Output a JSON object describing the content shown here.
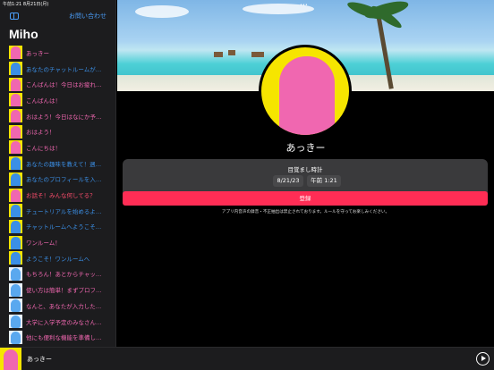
{
  "status": {
    "time": "午前1:21",
    "date": "8月21日(月)"
  },
  "sidebar": {
    "contact_label": "お問い合わせ",
    "title": "Miho",
    "items": [
      {
        "avatar": "pink",
        "text": "あっきー",
        "color": "pink"
      },
      {
        "avatar": "blue",
        "text": "あなたのチャットルームが…",
        "color": "blue"
      },
      {
        "avatar": "pink",
        "text": "こんばんは！今日はお疲れ…",
        "color": "pink"
      },
      {
        "avatar": "pink",
        "text": "こんばんは！",
        "color": "pink"
      },
      {
        "avatar": "pink",
        "text": "おはよう！今日はなにか予…",
        "color": "pink"
      },
      {
        "avatar": "pink",
        "text": "おはよう！",
        "color": "pink"
      },
      {
        "avatar": "pink",
        "text": "こんにちは！",
        "color": "pink"
      },
      {
        "avatar": "blue",
        "text": "あなたの趣味を教えて！週…",
        "color": "blue"
      },
      {
        "avatar": "blue",
        "text": "あなたのプロフィールを入…",
        "color": "blue"
      },
      {
        "avatar": "pink",
        "text": "お話そ！みんな何してる？",
        "color": "red"
      },
      {
        "avatar": "blue",
        "text": "チュートリアルを始めるよ…",
        "color": "blue"
      },
      {
        "avatar": "blue",
        "text": "チャットルームへようこそ…",
        "color": "blue"
      },
      {
        "avatar": "blue",
        "text": "ワンルーム！",
        "color": "pink"
      },
      {
        "avatar": "blue",
        "text": "ようこそ！ワンルームへ",
        "color": "blue"
      },
      {
        "avatar": "ai",
        "text": "もちろん！あとからチャッ…",
        "color": "pink"
      },
      {
        "avatar": "ai",
        "text": "使い方は簡単！まずプロフ…",
        "color": "pink"
      },
      {
        "avatar": "ai",
        "text": "なんと、あなたが入力した…",
        "color": "pink"
      },
      {
        "avatar": "ai",
        "text": "大学に入学予定のみなさん…",
        "color": "pink"
      },
      {
        "avatar": "ai",
        "text": "他にも便利な機能を準備し…",
        "color": "pink"
      }
    ]
  },
  "main": {
    "profile_name": "あっきー",
    "alarm": {
      "title": "目覚まし時計",
      "date_value": "8/21/23",
      "time_value": "午前 1:21",
      "register_label": "登録",
      "notice": "アプリ内音声の録音・不正抽出は禁止されております。ルールを守ってお楽しみください。"
    }
  },
  "player": {
    "name": "あっきー"
  },
  "colors": {
    "accent": "#4a9df8",
    "pink": "#f067b0",
    "register": "#ff2d55",
    "yellow": "#f6e500"
  },
  "icons": [
    "sidebar-toggle-icon",
    "play-icon"
  ]
}
